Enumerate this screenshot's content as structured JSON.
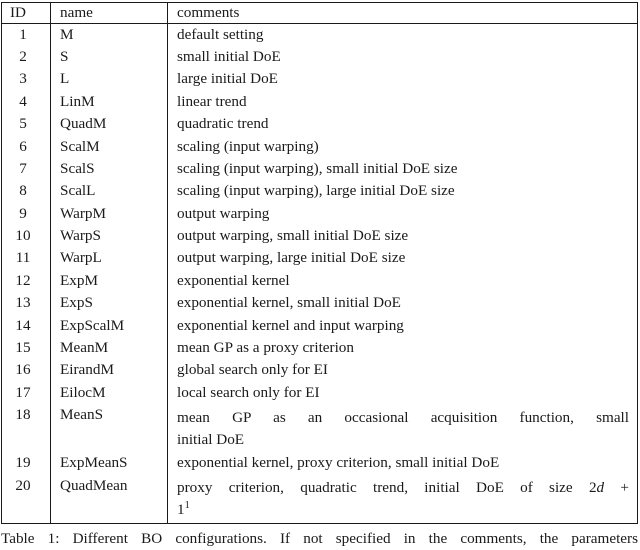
{
  "table": {
    "headers": {
      "id": "ID",
      "name": "name",
      "comments": "comments"
    },
    "rows": [
      {
        "id": "1",
        "name": "M",
        "comment": "default setting"
      },
      {
        "id": "2",
        "name": "S",
        "comment": "small initial DoE"
      },
      {
        "id": "3",
        "name": "L",
        "comment": "large initial DoE"
      },
      {
        "id": "4",
        "name": "LinM",
        "comment": "linear trend"
      },
      {
        "id": "5",
        "name": "QuadM",
        "comment": "quadratic trend"
      },
      {
        "id": "6",
        "name": "ScalM",
        "comment": "scaling (input warping)"
      },
      {
        "id": "7",
        "name": "ScalS",
        "comment": "scaling (input warping), small initial DoE size"
      },
      {
        "id": "8",
        "name": "ScalL",
        "comment": "scaling (input warping), large initial DoE size"
      },
      {
        "id": "9",
        "name": "WarpM",
        "comment": "output warping"
      },
      {
        "id": "10",
        "name": "WarpS",
        "comment": "output warping, small initial DoE size"
      },
      {
        "id": "11",
        "name": "WarpL",
        "comment": "output warping, large initial DoE size"
      },
      {
        "id": "12",
        "name": "ExpM",
        "comment": "exponential kernel"
      },
      {
        "id": "13",
        "name": "ExpS",
        "comment": "exponential kernel, small initial DoE"
      },
      {
        "id": "14",
        "name": "ExpScalM",
        "comment": "exponential kernel and input warping"
      },
      {
        "id": "15",
        "name": "MeanM",
        "comment": "mean GP as a proxy criterion"
      },
      {
        "id": "16",
        "name": "EirandM",
        "comment": "global search only for EI"
      },
      {
        "id": "17",
        "name": "EilocM",
        "comment": "local search only for EI"
      },
      {
        "id": "18",
        "name": "MeanS",
        "comment": "mean GP as an occasional acquisition function, small initial DoE",
        "line1": "mean GP as an occasional acquisition function, small",
        "line2": "initial DoE"
      },
      {
        "id": "19",
        "name": "ExpMeanS",
        "comment": "exponential kernel, proxy criterion, small initial DoE"
      },
      {
        "id": "20",
        "name": "QuadMean",
        "comment": "proxy criterion, quadratic trend, initial DoE of size 2d + 1",
        "line1_pre": "proxy criterion, quadratic trend, initial DoE of size 2",
        "line1_var": "d",
        "line1_post": " +",
        "line2": "1",
        "footnote_marker": "1"
      }
    ]
  },
  "caption": {
    "text": "Table 1: Different BO configurations. If not specified in the comments, the parameters"
  },
  "colors": {
    "rule": "#1a1a1a",
    "text": "#1a1a1a",
    "background": "#ffffff"
  }
}
